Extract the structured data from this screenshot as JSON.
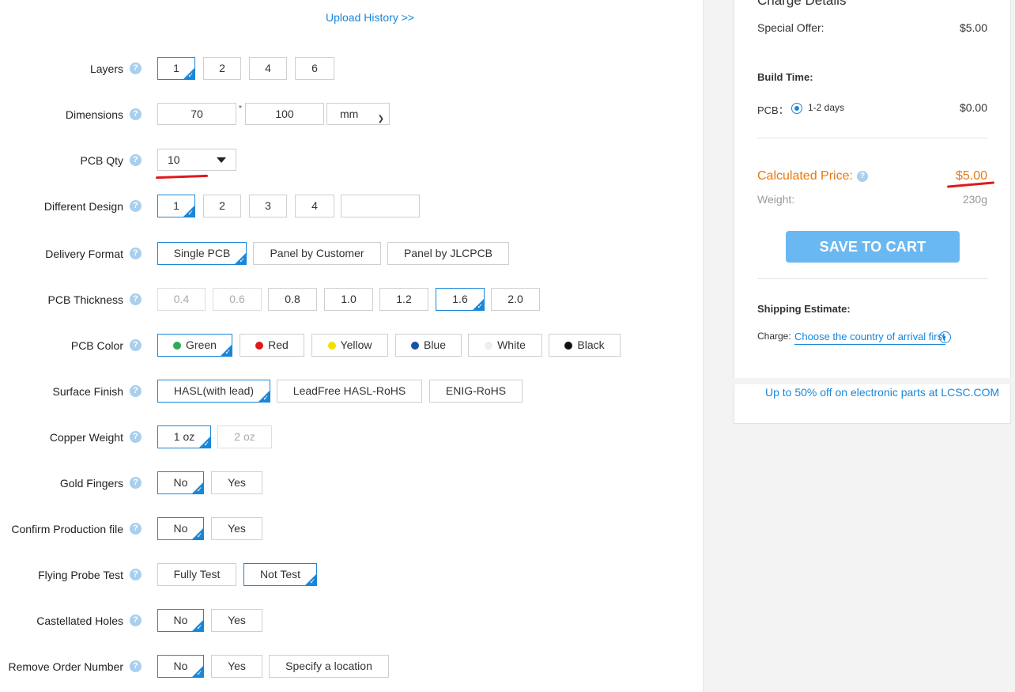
{
  "upload_history": "Upload History >>",
  "help_glyph": "?",
  "rows": {
    "layers": {
      "label": "Layers",
      "options": [
        "1",
        "2",
        "4",
        "6"
      ],
      "selected": "1"
    },
    "dimensions": {
      "label": "Dimensions",
      "width": "70",
      "height": "100",
      "separator": "*",
      "unit": "mm"
    },
    "pcb_qty": {
      "label": "PCB Qty",
      "value": "10"
    },
    "different_design": {
      "label": "Different Design",
      "options": [
        "1",
        "2",
        "3",
        "4"
      ],
      "custom_value": "",
      "selected": "1"
    },
    "delivery_format": {
      "label": "Delivery Format",
      "options": [
        "Single PCB",
        "Panel by Customer",
        "Panel by JLCPCB"
      ],
      "selected": "Single PCB"
    },
    "pcb_thickness": {
      "label": "PCB Thickness",
      "options": [
        "0.4",
        "0.6",
        "0.8",
        "1.0",
        "1.2",
        "1.6",
        "2.0"
      ],
      "disabled": [
        "0.4",
        "0.6"
      ],
      "selected": "1.6"
    },
    "pcb_color": {
      "label": "PCB Color",
      "options": [
        {
          "name": "Green",
          "color": "#2eaa55"
        },
        {
          "name": "Red",
          "color": "#e0191b"
        },
        {
          "name": "Yellow",
          "color": "#f2e100"
        },
        {
          "name": "Blue",
          "color": "#1653a6"
        },
        {
          "name": "White",
          "color": "#eeeeee"
        },
        {
          "name": "Black",
          "color": "#111111"
        }
      ],
      "selected": "Green"
    },
    "surface_finish": {
      "label": "Surface Finish",
      "options": [
        "HASL(with lead)",
        "LeadFree HASL-RoHS",
        "ENIG-RoHS"
      ],
      "selected": "HASL(with lead)"
    },
    "copper_weight": {
      "label": "Copper Weight",
      "options": [
        "1 oz",
        "2 oz"
      ],
      "disabled": [
        "2 oz"
      ],
      "selected": "1 oz"
    },
    "gold_fingers": {
      "label": "Gold Fingers",
      "options": [
        "No",
        "Yes"
      ],
      "selected": "No"
    },
    "confirm_production_file": {
      "label": "Confirm Production file",
      "options": [
        "No",
        "Yes"
      ],
      "selected": "No"
    },
    "flying_probe_test": {
      "label": "Flying Probe Test",
      "options": [
        "Fully Test",
        "Not Test"
      ],
      "selected": "Not Test"
    },
    "castellated_holes": {
      "label": "Castellated Holes",
      "options": [
        "No",
        "Yes"
      ],
      "selected": "No"
    },
    "remove_order_number": {
      "label": "Remove Order Number",
      "options": [
        "No",
        "Yes",
        "Specify a location"
      ],
      "selected": "No"
    }
  },
  "charge": {
    "title": "Charge Details",
    "special_offer_label": "Special Offer:",
    "special_offer_value": "$5.00",
    "build_time_label": "Build Time:",
    "pcb_label": "PCB：",
    "build_option": "1-2 days",
    "build_price": "$0.00",
    "calculated_label": "Calculated Price:",
    "calculated_value": "$5.00",
    "weight_label": "Weight:",
    "weight_value": "230g",
    "save_button": "SAVE TO CART",
    "shipping_label": "Shipping Estimate:",
    "charge_label": "Charge:",
    "country_link": "Choose the country of arrival first",
    "accent_color": "#1a86d8",
    "price_color": "#e8790f"
  },
  "promo": "Up to 50% off on electronic parts at LCSC.COM"
}
